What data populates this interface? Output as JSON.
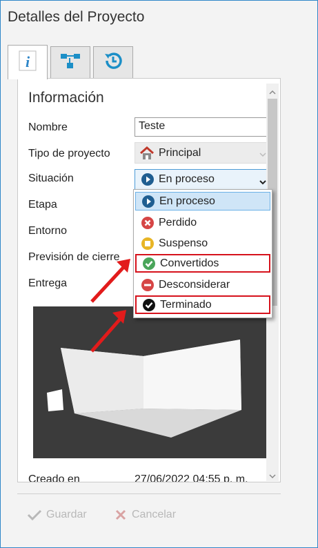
{
  "window": {
    "title": "Detalles del Proyecto"
  },
  "tabs": [
    {
      "name": "info",
      "icon": "info-icon"
    },
    {
      "name": "hierarchy",
      "icon": "hierarchy-icon"
    },
    {
      "name": "history",
      "icon": "history-icon"
    }
  ],
  "section": {
    "title": "Información"
  },
  "fields": {
    "nombre": {
      "label": "Nombre",
      "value": "Teste"
    },
    "tipo": {
      "label": "Tipo de proyecto",
      "value": "Principal"
    },
    "situacion": {
      "label": "Situación",
      "value": "En proceso"
    },
    "etapa": {
      "label": "Etapa"
    },
    "entorno": {
      "label": "Entorno"
    },
    "prevision": {
      "label": "Previsión de cierre"
    },
    "entrega": {
      "label": "Entrega"
    },
    "creado": {
      "label": "Creado en",
      "value": "27/06/2022 04:55 p. m."
    }
  },
  "dropdown": {
    "options": [
      "En proceso",
      "Perdido",
      "Suspenso",
      "Convertidos",
      "Desconsiderar",
      "Terminado"
    ],
    "selected": "En proceso",
    "highlighted": [
      "Convertidos",
      "Terminado"
    ]
  },
  "buttons": {
    "save": "Guardar",
    "cancel": "Cancelar"
  },
  "colors": {
    "accent": "#2e86c8",
    "highlight": "#d6111b",
    "green": "#4aa55a",
    "red": "#d64545",
    "yellow": "#e8b526",
    "blue": "#1f5e91"
  }
}
